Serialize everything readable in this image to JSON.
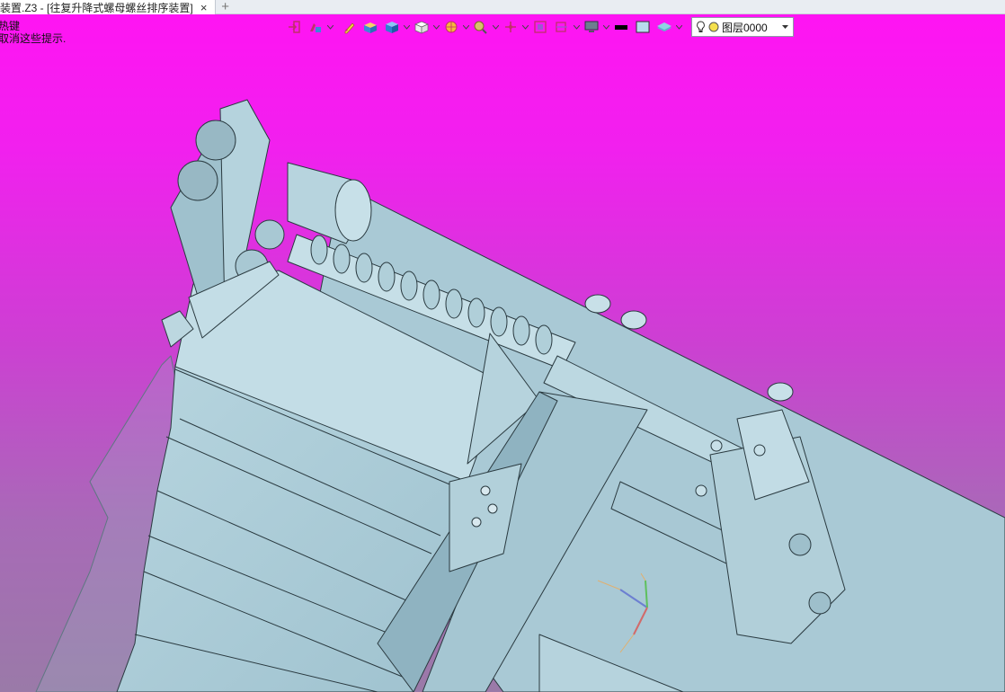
{
  "tab": {
    "title": "装置.Z3 - [往复升降式螺母螺丝排序装置]"
  },
  "hints": [
    "热键",
    "取消这些提示."
  ],
  "toolbar": {
    "icons": [
      "exit-sketch-icon",
      "appearance-icon",
      "pen-icon",
      "solid-box-icon",
      "shaded-cube-icon",
      "white-cube-icon",
      "sun-render-icon",
      "zoom-view-icon",
      "transform-icon",
      "clipboard-icon",
      "section-icon",
      "monitor-icon",
      "line-color-icon",
      "fill-color-icon",
      "layer-plane-icon"
    ],
    "layer": {
      "name": "图层0000"
    }
  },
  "colors": {
    "background_top": "#ff14f3",
    "background_bottom": "#9a7aa8",
    "model": "#aecdd8",
    "model_edges": "#2a3a40"
  }
}
